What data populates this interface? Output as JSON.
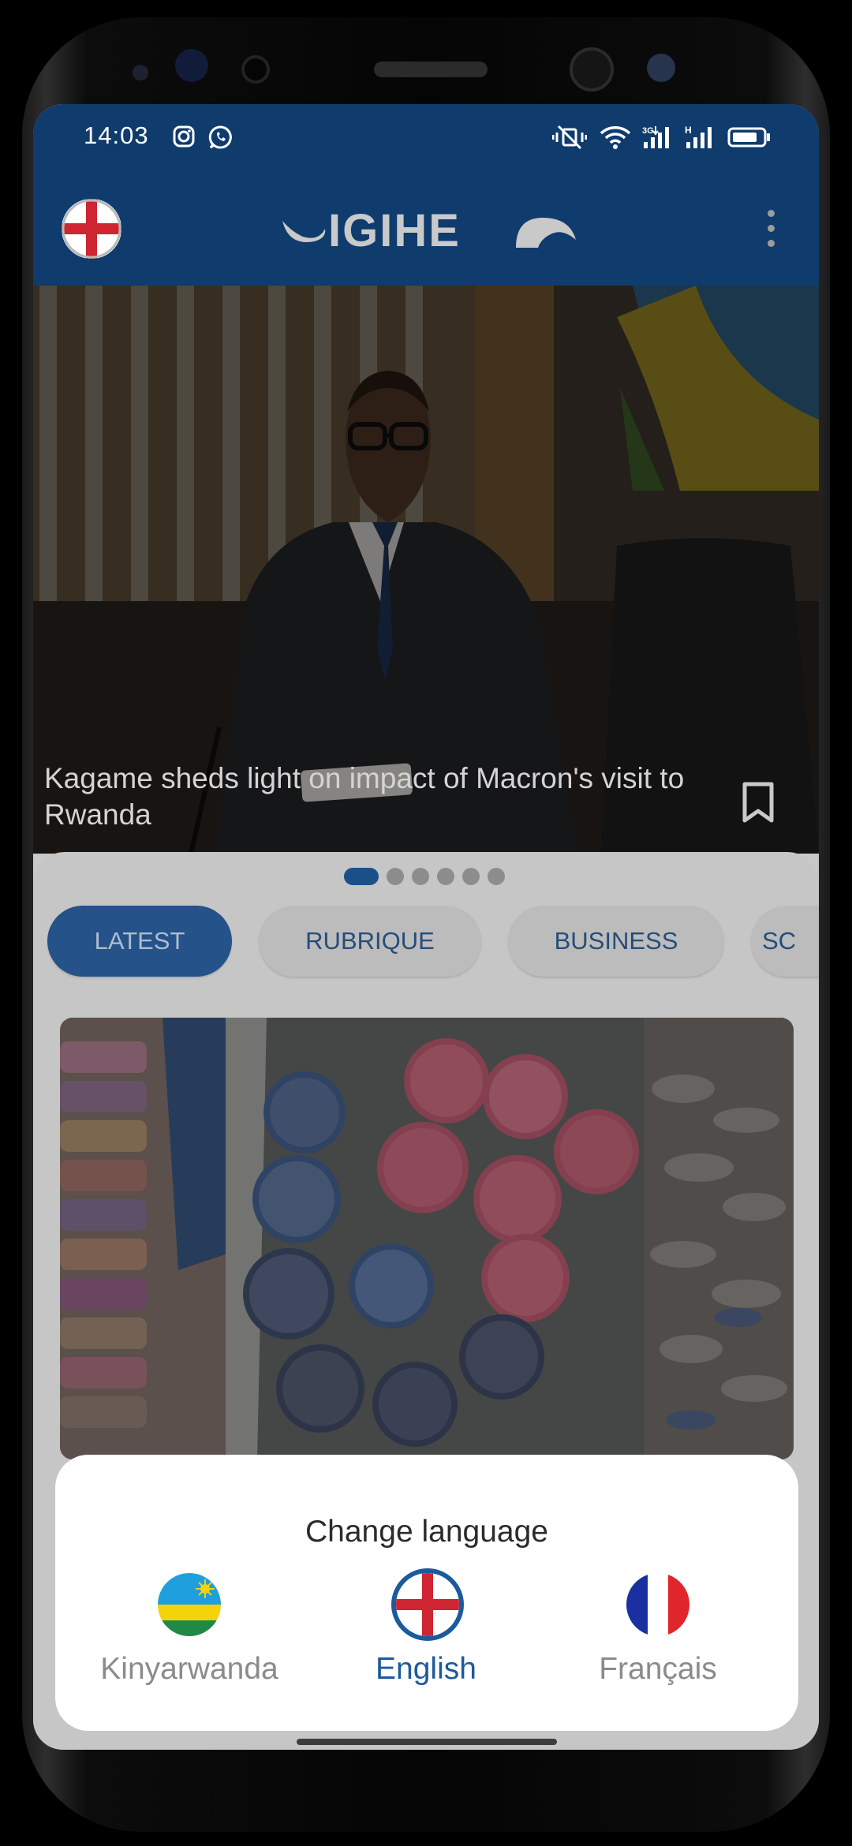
{
  "status_bar": {
    "time": "14:03"
  },
  "app_bar": {
    "logo_text": "IGIHE"
  },
  "hero": {
    "headline": "Kagame sheds light on impact of Macron's visit to Rwanda"
  },
  "carousel": {
    "active_index": 0,
    "count": 6
  },
  "tabs": [
    {
      "label": "LATEST",
      "active": true
    },
    {
      "label": "RUBRIQUE",
      "active": false
    },
    {
      "label": "BUSINESS",
      "active": false
    },
    {
      "label": "SC",
      "active": false
    }
  ],
  "language_sheet": {
    "title": "Change language",
    "options": [
      {
        "label": "Kinyarwanda",
        "flag": "rwanda-flag-icon",
        "selected": false
      },
      {
        "label": "English",
        "flag": "england-flag-icon",
        "selected": true
      },
      {
        "label": "Français",
        "flag": "france-flag-icon",
        "selected": false
      }
    ]
  },
  "colors": {
    "brand_blue": "#0f3b6d",
    "tab_active": "#245289",
    "selected_language": "#1c5a9c"
  }
}
